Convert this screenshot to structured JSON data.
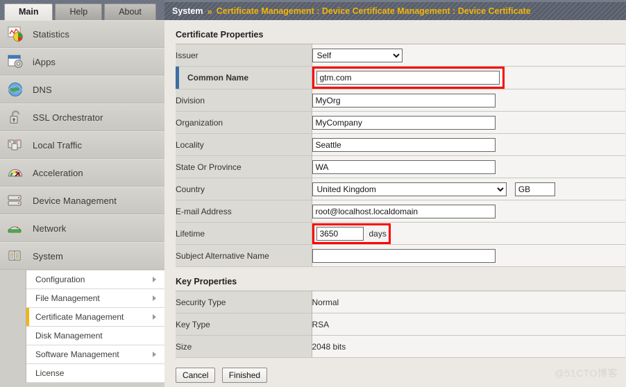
{
  "tabs": [
    {
      "label": "Main",
      "active": true
    },
    {
      "label": "Help",
      "active": false
    },
    {
      "label": "About",
      "active": false
    }
  ],
  "sidebar": {
    "items": [
      {
        "label": "Statistics",
        "icon": "statistics-chart-icon"
      },
      {
        "label": "iApps",
        "icon": "iapps-window-gear-icon"
      },
      {
        "label": "DNS",
        "icon": "dns-globe-icon"
      },
      {
        "label": "SSL Orchestrator",
        "icon": "ssl-padlock-icon"
      },
      {
        "label": "Local Traffic",
        "icon": "local-traffic-servers-icon"
      },
      {
        "label": "Acceleration",
        "icon": "acceleration-gauge-icon"
      },
      {
        "label": "Device Management",
        "icon": "device-management-rack-icon"
      },
      {
        "label": "Network",
        "icon": "network-switch-icon"
      },
      {
        "label": "System",
        "icon": "system-panel-icon"
      }
    ],
    "submenu": [
      {
        "label": "Configuration",
        "has_arrow": true,
        "active": false
      },
      {
        "label": "File Management",
        "has_arrow": true,
        "active": false
      },
      {
        "label": "Certificate Management",
        "has_arrow": true,
        "active": true
      },
      {
        "label": "Disk Management",
        "has_arrow": false,
        "active": false
      },
      {
        "label": "Software Management",
        "has_arrow": true,
        "active": false
      },
      {
        "label": "License",
        "has_arrow": false,
        "active": false
      }
    ]
  },
  "breadcrumb": {
    "root": "System",
    "separator": "»",
    "path": "Certificate Management : Device Certificate Management : Device Certificate"
  },
  "certificate_properties": {
    "title": "Certificate Properties",
    "rows": {
      "issuer": {
        "label": "Issuer",
        "value": "Self"
      },
      "common_name": {
        "label": "Common Name",
        "value": "gtm.com"
      },
      "division": {
        "label": "Division",
        "value": "MyOrg"
      },
      "organization": {
        "label": "Organization",
        "value": "MyCompany"
      },
      "locality": {
        "label": "Locality",
        "value": "Seattle"
      },
      "state": {
        "label": "State Or Province",
        "value": "WA"
      },
      "country": {
        "label": "Country",
        "value": "United Kingdom",
        "code": "GB"
      },
      "email": {
        "label": "E-mail Address",
        "value": "root@localhost.localdomain"
      },
      "lifetime": {
        "label": "Lifetime",
        "value": "3650",
        "unit": "days"
      },
      "san": {
        "label": "Subject Alternative Name",
        "value": "",
        "placeholder": ""
      }
    }
  },
  "key_properties": {
    "title": "Key Properties",
    "rows": [
      {
        "label": "Security Type",
        "value": "Normal"
      },
      {
        "label": "Key Type",
        "value": "RSA"
      },
      {
        "label": "Size",
        "value": "2048 bits"
      }
    ]
  },
  "buttons": {
    "cancel": "Cancel",
    "finished": "Finished"
  },
  "watermark": "@51CTO博客",
  "colors": {
    "highlight_red": "#ff0000",
    "active_submenu_accent": "#f2b50d",
    "row_highlight_accent": "#3c6ea5",
    "breadcrumb_path": "#f5b50a",
    "header_bar": "#5d6471"
  }
}
